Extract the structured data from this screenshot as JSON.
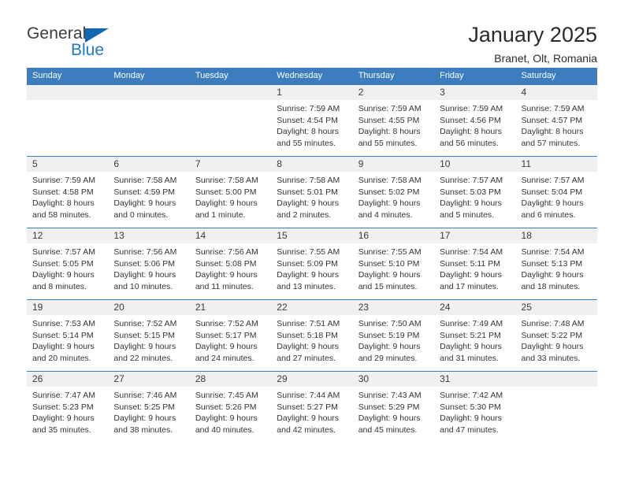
{
  "brand": {
    "line1": "General",
    "line2": "Blue",
    "triangle_color": "#1267b0",
    "blue_text_color": "#1f7ac4"
  },
  "header": {
    "title": "January 2025",
    "subtitle": "Branet, Olt, Romania"
  },
  "theme": {
    "header_blue": "#3c7dc0",
    "daynum_band": "#f0f0f0",
    "text": "#333333"
  },
  "weekdays": [
    "Sunday",
    "Monday",
    "Tuesday",
    "Wednesday",
    "Thursday",
    "Friday",
    "Saturday"
  ],
  "weeks": [
    [
      {
        "day": "",
        "lines": [
          "",
          "",
          "",
          ""
        ]
      },
      {
        "day": "",
        "lines": [
          "",
          "",
          "",
          ""
        ]
      },
      {
        "day": "",
        "lines": [
          "",
          "",
          "",
          ""
        ]
      },
      {
        "day": "1",
        "lines": [
          "Sunrise: 7:59 AM",
          "Sunset: 4:54 PM",
          "Daylight: 8 hours",
          "and 55 minutes."
        ]
      },
      {
        "day": "2",
        "lines": [
          "Sunrise: 7:59 AM",
          "Sunset: 4:55 PM",
          "Daylight: 8 hours",
          "and 55 minutes."
        ]
      },
      {
        "day": "3",
        "lines": [
          "Sunrise: 7:59 AM",
          "Sunset: 4:56 PM",
          "Daylight: 8 hours",
          "and 56 minutes."
        ]
      },
      {
        "day": "4",
        "lines": [
          "Sunrise: 7:59 AM",
          "Sunset: 4:57 PM",
          "Daylight: 8 hours",
          "and 57 minutes."
        ]
      }
    ],
    [
      {
        "day": "5",
        "lines": [
          "Sunrise: 7:59 AM",
          "Sunset: 4:58 PM",
          "Daylight: 8 hours",
          "and 58 minutes."
        ]
      },
      {
        "day": "6",
        "lines": [
          "Sunrise: 7:58 AM",
          "Sunset: 4:59 PM",
          "Daylight: 9 hours",
          "and 0 minutes."
        ]
      },
      {
        "day": "7",
        "lines": [
          "Sunrise: 7:58 AM",
          "Sunset: 5:00 PM",
          "Daylight: 9 hours",
          "and 1 minute."
        ]
      },
      {
        "day": "8",
        "lines": [
          "Sunrise: 7:58 AM",
          "Sunset: 5:01 PM",
          "Daylight: 9 hours",
          "and 2 minutes."
        ]
      },
      {
        "day": "9",
        "lines": [
          "Sunrise: 7:58 AM",
          "Sunset: 5:02 PM",
          "Daylight: 9 hours",
          "and 4 minutes."
        ]
      },
      {
        "day": "10",
        "lines": [
          "Sunrise: 7:57 AM",
          "Sunset: 5:03 PM",
          "Daylight: 9 hours",
          "and 5 minutes."
        ]
      },
      {
        "day": "11",
        "lines": [
          "Sunrise: 7:57 AM",
          "Sunset: 5:04 PM",
          "Daylight: 9 hours",
          "and 6 minutes."
        ]
      }
    ],
    [
      {
        "day": "12",
        "lines": [
          "Sunrise: 7:57 AM",
          "Sunset: 5:05 PM",
          "Daylight: 9 hours",
          "and 8 minutes."
        ]
      },
      {
        "day": "13",
        "lines": [
          "Sunrise: 7:56 AM",
          "Sunset: 5:06 PM",
          "Daylight: 9 hours",
          "and 10 minutes."
        ]
      },
      {
        "day": "14",
        "lines": [
          "Sunrise: 7:56 AM",
          "Sunset: 5:08 PM",
          "Daylight: 9 hours",
          "and 11 minutes."
        ]
      },
      {
        "day": "15",
        "lines": [
          "Sunrise: 7:55 AM",
          "Sunset: 5:09 PM",
          "Daylight: 9 hours",
          "and 13 minutes."
        ]
      },
      {
        "day": "16",
        "lines": [
          "Sunrise: 7:55 AM",
          "Sunset: 5:10 PM",
          "Daylight: 9 hours",
          "and 15 minutes."
        ]
      },
      {
        "day": "17",
        "lines": [
          "Sunrise: 7:54 AM",
          "Sunset: 5:11 PM",
          "Daylight: 9 hours",
          "and 17 minutes."
        ]
      },
      {
        "day": "18",
        "lines": [
          "Sunrise: 7:54 AM",
          "Sunset: 5:13 PM",
          "Daylight: 9 hours",
          "and 18 minutes."
        ]
      }
    ],
    [
      {
        "day": "19",
        "lines": [
          "Sunrise: 7:53 AM",
          "Sunset: 5:14 PM",
          "Daylight: 9 hours",
          "and 20 minutes."
        ]
      },
      {
        "day": "20",
        "lines": [
          "Sunrise: 7:52 AM",
          "Sunset: 5:15 PM",
          "Daylight: 9 hours",
          "and 22 minutes."
        ]
      },
      {
        "day": "21",
        "lines": [
          "Sunrise: 7:52 AM",
          "Sunset: 5:17 PM",
          "Daylight: 9 hours",
          "and 24 minutes."
        ]
      },
      {
        "day": "22",
        "lines": [
          "Sunrise: 7:51 AM",
          "Sunset: 5:18 PM",
          "Daylight: 9 hours",
          "and 27 minutes."
        ]
      },
      {
        "day": "23",
        "lines": [
          "Sunrise: 7:50 AM",
          "Sunset: 5:19 PM",
          "Daylight: 9 hours",
          "and 29 minutes."
        ]
      },
      {
        "day": "24",
        "lines": [
          "Sunrise: 7:49 AM",
          "Sunset: 5:21 PM",
          "Daylight: 9 hours",
          "and 31 minutes."
        ]
      },
      {
        "day": "25",
        "lines": [
          "Sunrise: 7:48 AM",
          "Sunset: 5:22 PM",
          "Daylight: 9 hours",
          "and 33 minutes."
        ]
      }
    ],
    [
      {
        "day": "26",
        "lines": [
          "Sunrise: 7:47 AM",
          "Sunset: 5:23 PM",
          "Daylight: 9 hours",
          "and 35 minutes."
        ]
      },
      {
        "day": "27",
        "lines": [
          "Sunrise: 7:46 AM",
          "Sunset: 5:25 PM",
          "Daylight: 9 hours",
          "and 38 minutes."
        ]
      },
      {
        "day": "28",
        "lines": [
          "Sunrise: 7:45 AM",
          "Sunset: 5:26 PM",
          "Daylight: 9 hours",
          "and 40 minutes."
        ]
      },
      {
        "day": "29",
        "lines": [
          "Sunrise: 7:44 AM",
          "Sunset: 5:27 PM",
          "Daylight: 9 hours",
          "and 42 minutes."
        ]
      },
      {
        "day": "30",
        "lines": [
          "Sunrise: 7:43 AM",
          "Sunset: 5:29 PM",
          "Daylight: 9 hours",
          "and 45 minutes."
        ]
      },
      {
        "day": "31",
        "lines": [
          "Sunrise: 7:42 AM",
          "Sunset: 5:30 PM",
          "Daylight: 9 hours",
          "and 47 minutes."
        ]
      },
      {
        "day": "",
        "lines": [
          "",
          "",
          "",
          ""
        ]
      }
    ]
  ]
}
